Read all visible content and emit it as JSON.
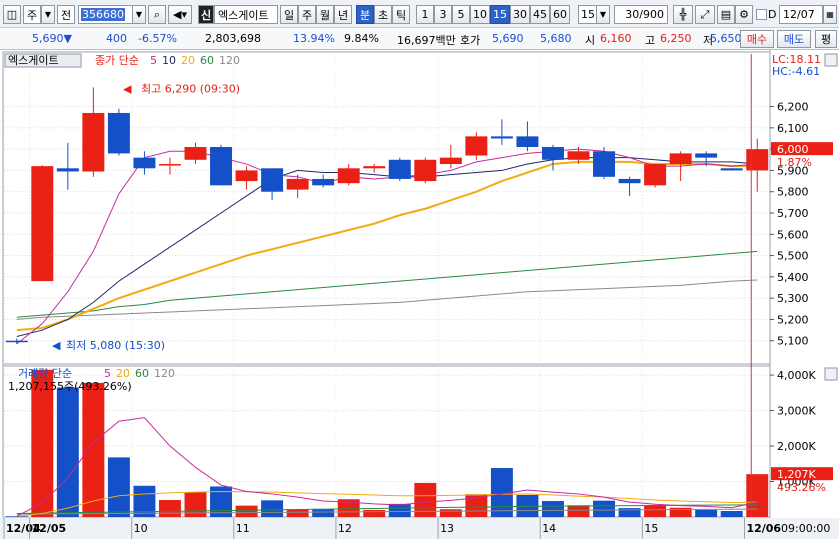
{
  "toolbar": {
    "market": "주",
    "prev": "전",
    "stock_code": "356680",
    "stock_badge": "신",
    "stock_name": "엑스게이트",
    "periods": [
      "일",
      "주",
      "월",
      "년",
      "분",
      "초",
      "틱"
    ],
    "active_period": "분",
    "intervals": [
      "1",
      "3",
      "5",
      "10",
      "15",
      "30",
      "45",
      "60"
    ],
    "active_interval": "15",
    "interval_select": "15",
    "count": "30/900",
    "date": "12/07",
    "date_prefix": "D"
  },
  "quote": {
    "price": "5,690▼",
    "change": "400",
    "change_pct": "-6.57%",
    "volume": "2,803,698",
    "turnover_pct": "13.94%",
    "volume_ratio": "9.84%",
    "trade_amount": "16,697백만",
    "ask_label": "호가",
    "ask": "5,690",
    "bid": "5,680",
    "open_label": "시",
    "open": "6,160",
    "high_label": "고",
    "high": "6,250",
    "low_label": "저",
    "low": "5,650",
    "buy_button": "매수",
    "sell_button": "매도",
    "eval_button": "평"
  },
  "price_panel": {
    "stock_name": "엑스게이트",
    "legend_prefix": "종가 단순",
    "ma_labels": [
      "5",
      "10",
      "20",
      "60",
      "120"
    ],
    "high_annotation": "최고 6,290 (09:30)",
    "low_annotation": "최저 5,080 (15:30)",
    "lc": "LC:18.11",
    "hc": "HC:-4.61",
    "current_price_tag": "6,000",
    "current_pct_tag": "1.87%"
  },
  "volume_panel": {
    "legend_prefix": "거래량 단순",
    "ma_labels": [
      "5",
      "20",
      "60",
      "120"
    ],
    "summary": "1,207,155주(493.26%)",
    "current_tag": "1,207K",
    "current_pct": "493.26%"
  },
  "colors": {
    "up": "#ea2015",
    "down": "#1450c8",
    "ma5": "#c8289e",
    "ma10": "#1c2a6a",
    "ma20": "#f2ab10",
    "ma60": "#2a8a3e",
    "ma120": "#8a8a8a"
  },
  "chart_data": {
    "type": "candlestick",
    "price_axis": {
      "min": 5000,
      "max": 6400,
      "ticks": [
        5100,
        5200,
        5300,
        5400,
        5500,
        5600,
        5700,
        5800,
        5900,
        6000,
        6100,
        6200
      ]
    },
    "volume_axis": {
      "min": 0,
      "max": 4200000,
      "ticks": [
        1000000,
        2000000,
        3000000,
        4000000
      ],
      "tick_labels": [
        "1,000K",
        "2,000K",
        "3,000K",
        "4,000K"
      ]
    },
    "x_labels": [
      "12/04",
      "12/05",
      "10",
      "11",
      "12",
      "13",
      "14",
      "15",
      "12/06"
    ],
    "time_label": "09:00:00",
    "candles": [
      {
        "o": 5100,
        "h": 5110,
        "l": 5085,
        "c": 5095,
        "v": 20000
      },
      {
        "o": 5380,
        "h": 5925,
        "l": 5380,
        "c": 5920,
        "v": 4150000
      },
      {
        "o": 5910,
        "h": 6030,
        "l": 5810,
        "c": 5895,
        "v": 3650000
      },
      {
        "o": 5895,
        "h": 6290,
        "l": 5870,
        "c": 6170,
        "v": 3780000
      },
      {
        "o": 6170,
        "h": 6190,
        "l": 5970,
        "c": 5980,
        "v": 1680000
      },
      {
        "o": 5960,
        "h": 5990,
        "l": 5880,
        "c": 5910,
        "v": 880000
      },
      {
        "o": 5930,
        "h": 5960,
        "l": 5880,
        "c": 5930,
        "v": 480000
      },
      {
        "o": 5950,
        "h": 6030,
        "l": 5930,
        "c": 6010,
        "v": 700000
      },
      {
        "o": 6010,
        "h": 6020,
        "l": 5830,
        "c": 5830,
        "v": 860000
      },
      {
        "o": 5850,
        "h": 5920,
        "l": 5810,
        "c": 5900,
        "v": 320000
      },
      {
        "o": 5910,
        "h": 5910,
        "l": 5760,
        "c": 5800,
        "v": 470000
      },
      {
        "o": 5810,
        "h": 5880,
        "l": 5770,
        "c": 5860,
        "v": 210000
      },
      {
        "o": 5860,
        "h": 5880,
        "l": 5820,
        "c": 5830,
        "v": 230000
      },
      {
        "o": 5840,
        "h": 5930,
        "l": 5830,
        "c": 5910,
        "v": 500000
      },
      {
        "o": 5910,
        "h": 5930,
        "l": 5890,
        "c": 5920,
        "v": 200000
      },
      {
        "o": 5950,
        "h": 5960,
        "l": 5850,
        "c": 5860,
        "v": 370000
      },
      {
        "o": 5850,
        "h": 5960,
        "l": 5840,
        "c": 5950,
        "v": 960000
      },
      {
        "o": 5930,
        "h": 6020,
        "l": 5910,
        "c": 5960,
        "v": 220000
      },
      {
        "o": 5970,
        "h": 6080,
        "l": 5950,
        "c": 6060,
        "v": 640000
      },
      {
        "o": 6060,
        "h": 6140,
        "l": 6020,
        "c": 6050,
        "v": 1380000
      },
      {
        "o": 6060,
        "h": 6130,
        "l": 5990,
        "c": 6010,
        "v": 620000
      },
      {
        "o": 6010,
        "h": 6020,
        "l": 5900,
        "c": 5950,
        "v": 450000
      },
      {
        "o": 5950,
        "h": 6010,
        "l": 5930,
        "c": 5990,
        "v": 330000
      },
      {
        "o": 5990,
        "h": 6010,
        "l": 5860,
        "c": 5870,
        "v": 460000
      },
      {
        "o": 5860,
        "h": 5870,
        "l": 5780,
        "c": 5840,
        "v": 250000
      },
      {
        "o": 5830,
        "h": 5930,
        "l": 5820,
        "c": 5930,
        "v": 330000
      },
      {
        "o": 5930,
        "h": 5990,
        "l": 5850,
        "c": 5980,
        "v": 260000
      },
      {
        "o": 5980,
        "h": 5990,
        "l": 5920,
        "c": 5960,
        "v": 200000
      },
      {
        "o": 5910,
        "h": 5910,
        "l": 5900,
        "c": 5900,
        "v": 170000
      },
      {
        "o": 5900,
        "h": 6050,
        "l": 5800,
        "c": 6000,
        "v": 1207155
      }
    ],
    "ma5": [
      5085,
      5180,
      5330,
      5520,
      5790,
      5960,
      5990,
      5990,
      5960,
      5930,
      5880,
      5870,
      5840,
      5870,
      5860,
      5870,
      5880,
      5900,
      5940,
      5960,
      5980,
      5990,
      6000,
      5990,
      5960,
      5920,
      5920,
      5930,
      5920,
      5930
    ],
    "ma10": [
      5120,
      5150,
      5200,
      5280,
      5380,
      5460,
      5540,
      5620,
      5700,
      5780,
      5860,
      5900,
      5890,
      5890,
      5880,
      5870,
      5870,
      5880,
      5890,
      5900,
      5930,
      5950,
      5960,
      5960,
      5960,
      5950,
      5940,
      5940,
      5940,
      5930
    ],
    "ma20": [
      5150,
      5160,
      5200,
      5250,
      5300,
      5340,
      5380,
      5420,
      5460,
      5500,
      5530,
      5560,
      5590,
      5620,
      5650,
      5690,
      5720,
      5760,
      5800,
      5850,
      5890,
      5930,
      5940,
      5940,
      5940,
      5930,
      5930,
      5930,
      5920,
      5920
    ],
    "ma60": [
      5210,
      5220,
      5230,
      5240,
      5260,
      5270,
      5290,
      5300,
      5310,
      5320,
      5330,
      5340,
      5350,
      5360,
      5370,
      5380,
      5390,
      5400,
      5410,
      5420,
      5430,
      5440,
      5450,
      5460,
      5470,
      5480,
      5490,
      5500,
      5510,
      5520
    ],
    "ma120": [
      5200,
      5210,
      5215,
      5220,
      5225,
      5230,
      5235,
      5240,
      5245,
      5250,
      5255,
      5260,
      5265,
      5270,
      5275,
      5280,
      5290,
      5300,
      5310,
      5320,
      5330,
      5335,
      5340,
      5345,
      5350,
      5355,
      5360,
      5370,
      5380,
      5385
    ],
    "vma5": [
      20000,
      400000,
      1100000,
      2100000,
      2700000,
      2800000,
      2000000,
      1400000,
      900000,
      720000,
      650000,
      560000,
      450000,
      420000,
      370000,
      340000,
      420000,
      470000,
      540000,
      650000,
      760000,
      700000,
      650000,
      560000,
      420000,
      360000,
      320000,
      300000,
      260000,
      420000
    ],
    "vma20": [
      20000,
      100000,
      250000,
      450000,
      600000,
      650000,
      680000,
      700000,
      720000,
      710000,
      700000,
      680000,
      660000,
      640000,
      620000,
      600000,
      600000,
      610000,
      620000,
      640000,
      650000,
      620000,
      590000,
      560000,
      520000,
      480000,
      450000,
      430000,
      410000,
      420000
    ],
    "vma60": [
      100000,
      110000,
      120000,
      130000,
      140000,
      150000,
      160000,
      170000,
      180000,
      190000,
      200000,
      210000,
      220000,
      230000,
      240000,
      250000,
      260000,
      270000,
      280000,
      290000,
      300000,
      305000,
      310000,
      315000,
      320000,
      325000,
      330000,
      335000,
      340000,
      345000
    ],
    "vma120": [
      80000,
      85000,
      90000,
      95000,
      100000,
      105000,
      110000,
      115000,
      120000,
      125000,
      130000,
      135000,
      140000,
      145000,
      150000,
      155000,
      160000,
      165000,
      170000,
      175000,
      180000,
      185000,
      190000,
      195000,
      200000,
      205000,
      210000,
      215000,
      220000,
      225000
    ]
  }
}
